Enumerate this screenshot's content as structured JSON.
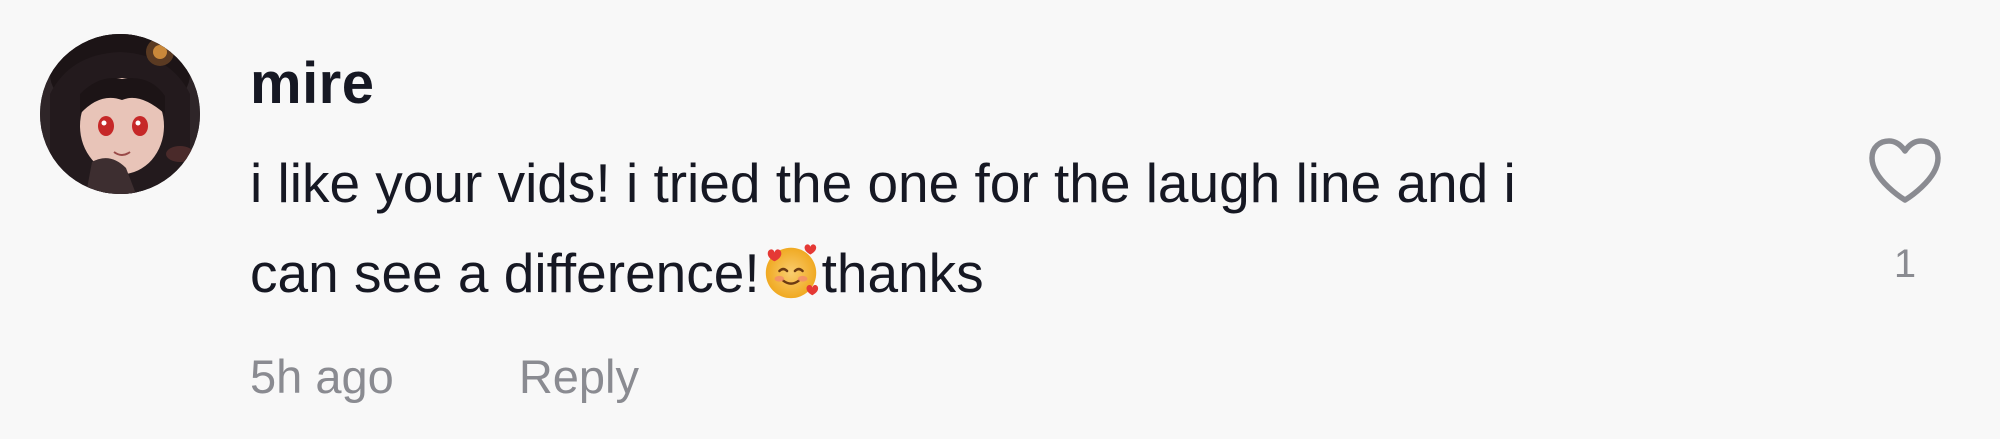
{
  "comment": {
    "username": "mire",
    "text_line1": "i like your vids! i tried the one for the laugh line and i",
    "text_line2_before": "can see a difference!",
    "text_line2_emoji": "smiling-face-with-hearts-emoji",
    "text_line2_after": "thanks",
    "timestamp": "5h ago",
    "reply_label": "Reply",
    "like_icon": "heart-outline-icon",
    "like_count": "1"
  },
  "colors": {
    "background": "#f8f8f8",
    "primary_text": "#161823",
    "secondary_text": "#8a8b91"
  }
}
